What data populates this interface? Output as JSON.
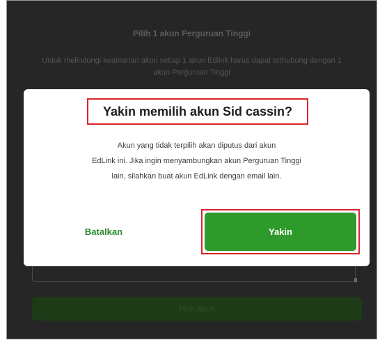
{
  "background": {
    "title": "Pilih 1 akun Perguruan Tinggi",
    "description": "Untuk melindungi keamanan akun setiap 1 akun Edlink harus dapat terhubung dengan 1 akun Perguruan Tinggi",
    "button_label": "Pilih Akun"
  },
  "dialog": {
    "title": "Yakin memilih akun Sid cassin?",
    "body_lines": [
      "Akun yang tidak terpilih akan diputus dari akun",
      "EdLink ini. Jika ingin menyambungkan akun Perguruan Tinggi",
      "lain, silahkan buat akun EdLink dengan email lain."
    ],
    "cancel_label": "Batalkan",
    "confirm_label": "Yakin"
  },
  "colors": {
    "accent": "#2f9a2c",
    "highlight": "#d8262a",
    "overlay": "#262626"
  }
}
